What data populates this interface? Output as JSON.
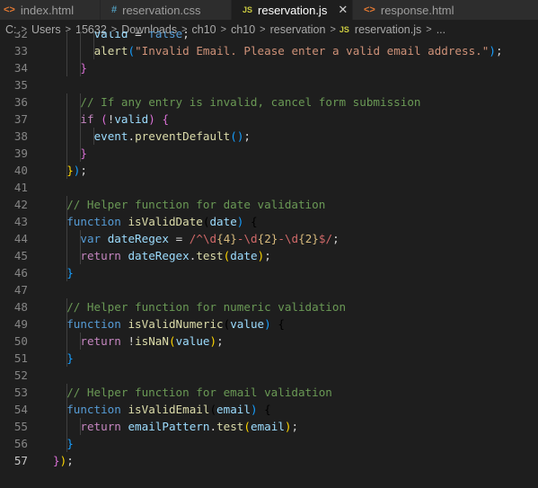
{
  "tabs": [
    {
      "label": "index.html",
      "icon": "html-file-icon",
      "active": false
    },
    {
      "label": "reservation.css",
      "icon": "css-file-icon",
      "active": false
    },
    {
      "label": "reservation.js",
      "icon": "js-file-icon",
      "active": true
    },
    {
      "label": "response.html",
      "icon": "html-file-icon",
      "active": false
    }
  ],
  "tab_icons": {
    "html": "<>",
    "css": "#",
    "js": "JS",
    "close": "✕"
  },
  "breadcrumb": {
    "items": [
      "C:",
      "Users",
      "15632",
      "Downloads",
      "ch10",
      "ch10",
      "reservation"
    ],
    "file": "reservation.js",
    "tail": "..."
  },
  "editor": {
    "current_line": "57",
    "lines": [
      {
        "n": "32",
        "t": "      valid = false;"
      },
      {
        "n": "33",
        "t": "      alert(\"Invalid Email. Please enter a valid email address.\");"
      },
      {
        "n": "34",
        "t": "    }"
      },
      {
        "n": "35",
        "t": ""
      },
      {
        "n": "36",
        "t": "    // If any entry is invalid, cancel form submission"
      },
      {
        "n": "37",
        "t": "    if (!valid) {"
      },
      {
        "n": "38",
        "t": "      event.preventDefault();"
      },
      {
        "n": "39",
        "t": "    }"
      },
      {
        "n": "40",
        "t": "  });"
      },
      {
        "n": "41",
        "t": ""
      },
      {
        "n": "42",
        "t": "  // Helper function for date validation"
      },
      {
        "n": "43",
        "t": "  function isValidDate(date) {"
      },
      {
        "n": "44",
        "t": "    var dateRegex = /^\\d{4}-\\d{2}-\\d{2}$/;"
      },
      {
        "n": "45",
        "t": "    return dateRegex.test(date);"
      },
      {
        "n": "46",
        "t": "  }"
      },
      {
        "n": "47",
        "t": ""
      },
      {
        "n": "48",
        "t": "  // Helper function for numeric validation"
      },
      {
        "n": "49",
        "t": "  function isValidNumeric(value) {"
      },
      {
        "n": "50",
        "t": "    return !isNaN(value);"
      },
      {
        "n": "51",
        "t": "  }"
      },
      {
        "n": "52",
        "t": ""
      },
      {
        "n": "53",
        "t": "  // Helper function for email validation"
      },
      {
        "n": "54",
        "t": "  function isValidEmail(email) {"
      },
      {
        "n": "55",
        "t": "    return emailPattern.test(email);"
      },
      {
        "n": "56",
        "t": "  }"
      },
      {
        "n": "57",
        "t": "});"
      }
    ]
  },
  "colors": {
    "editor_bg": "#1e1e1e",
    "keyword": "#569cd6",
    "function": "#dcdcaa",
    "variable": "#9cdcfe",
    "string": "#ce9178",
    "comment": "#6a9955"
  }
}
